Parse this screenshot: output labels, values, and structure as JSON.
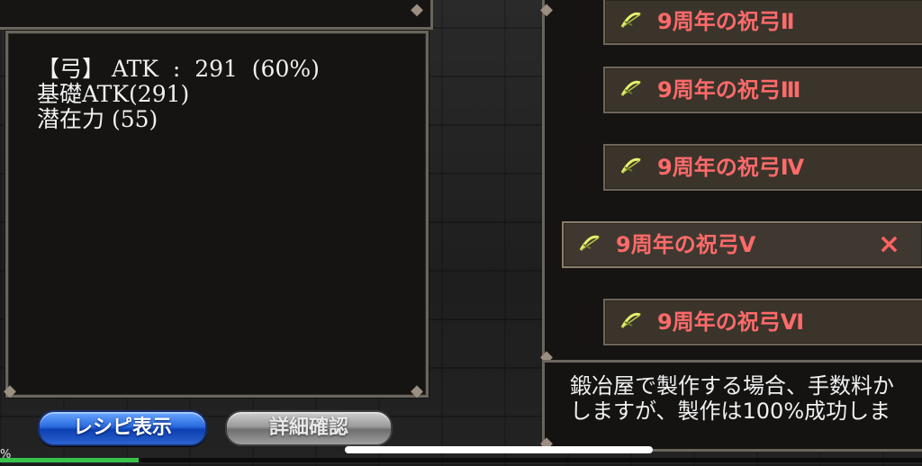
{
  "stats": {
    "atk_line": "【弓】 ATK  :  291  (60%)",
    "base_atk_line": "基礎ATK(291)",
    "potential_line": "潜在力 (55)"
  },
  "buttons": {
    "recipe_label": "レシピ表示",
    "detail_label": "詳細確認"
  },
  "list": {
    "items": [
      {
        "label": "9周年の祝弓Ⅱ"
      },
      {
        "label": "9周年の祝弓Ⅲ"
      },
      {
        "label": "9周年の祝弓Ⅳ"
      },
      {
        "label": "9周年の祝弓Ⅴ",
        "selected": true
      },
      {
        "label": "9周年の祝弓Ⅵ"
      }
    ],
    "remove_icon": "×",
    "item_icon": "bow-icon"
  },
  "description": {
    "line1": "鍛冶屋で製作する場合、手数料か",
    "line2": "しますが、製作は100%成功しま"
  },
  "progress": {
    "label": "%",
    "fraction": 0.15
  },
  "colors": {
    "item_text": "#ff6a6a",
    "progress_fill": "#39c24a"
  }
}
